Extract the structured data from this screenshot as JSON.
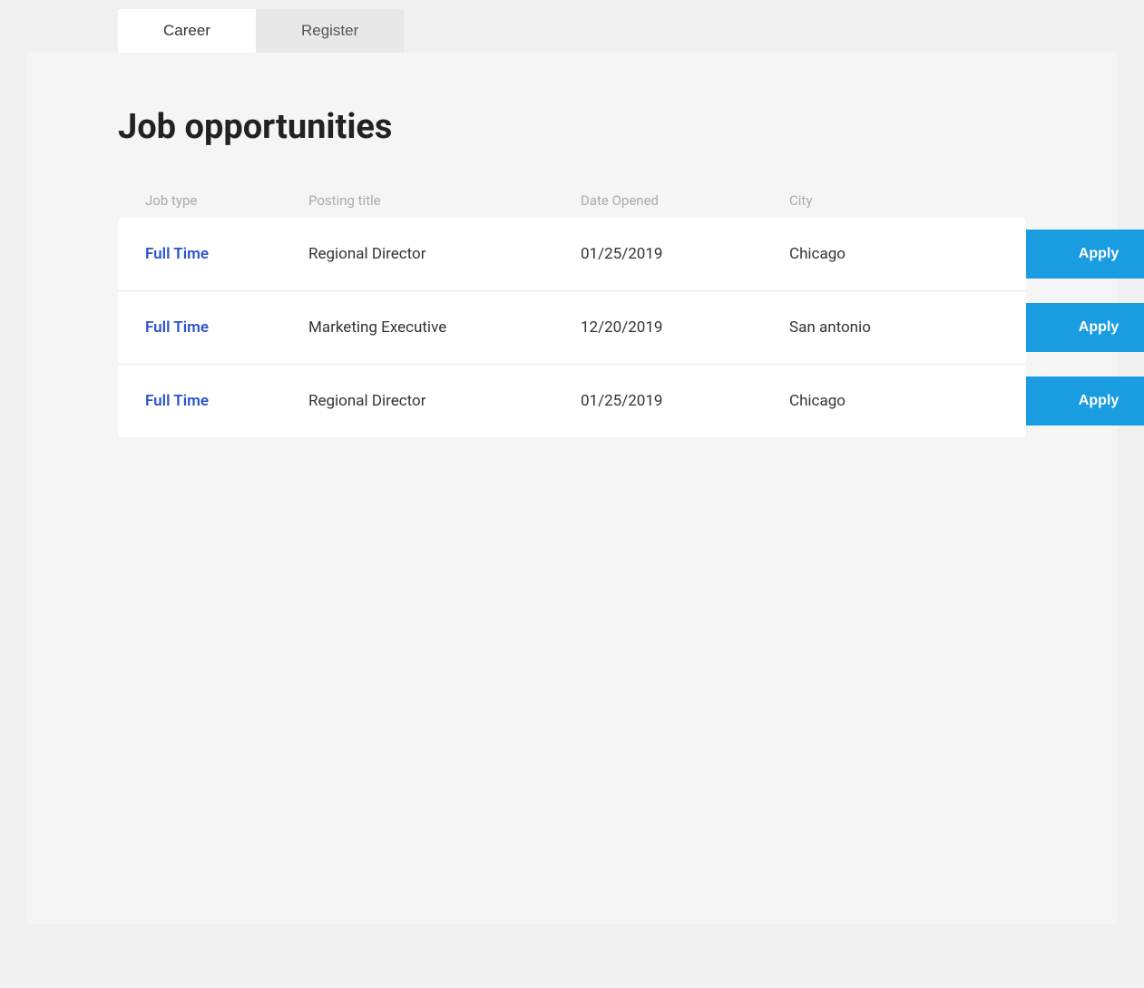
{
  "tabs": [
    {
      "id": "career",
      "label": "Career",
      "active": true
    },
    {
      "id": "register",
      "label": "Register",
      "active": false
    }
  ],
  "page": {
    "title": "Job opportunities"
  },
  "table": {
    "headers": [
      {
        "id": "job-type",
        "label": "Job type"
      },
      {
        "id": "posting-title",
        "label": "Posting title"
      },
      {
        "id": "date-opened",
        "label": "Date Opened"
      },
      {
        "id": "city",
        "label": "City"
      },
      {
        "id": "action",
        "label": ""
      }
    ],
    "rows": [
      {
        "id": "row-1",
        "job_type": "Full Time",
        "posting_title": "Regional Director",
        "date_opened": "01/25/2019",
        "city": "Chicago",
        "apply_label": "Apply"
      },
      {
        "id": "row-2",
        "job_type": "Full Time",
        "posting_title": "Marketing Executive",
        "date_opened": "12/20/2019",
        "city": "San antonio",
        "apply_label": "Apply"
      },
      {
        "id": "row-3",
        "job_type": "Full Time",
        "posting_title": "Regional Director",
        "date_opened": "01/25/2019",
        "city": "Chicago",
        "apply_label": "Apply"
      }
    ]
  }
}
